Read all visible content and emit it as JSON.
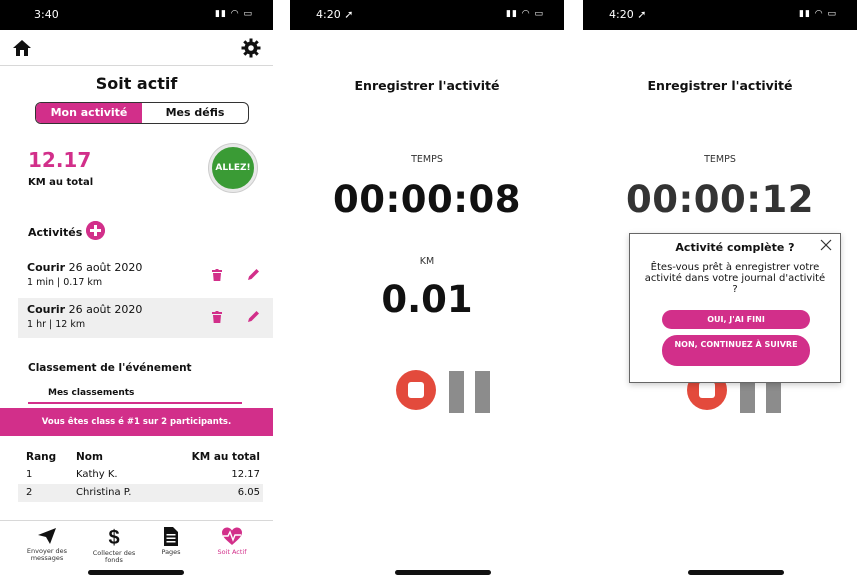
{
  "screen1": {
    "status_time": "3:40",
    "title": "Soit actif",
    "segment_tabs": [
      "Mon activité",
      "Mes défis"
    ],
    "total_value": "12.17",
    "total_label": "KM au total",
    "allez_label": "ALLEZ!",
    "activities_title": "Activités",
    "activities": [
      {
        "type": "Courir",
        "date": "26 août 2020",
        "details": "1 min | 0.17 km"
      },
      {
        "type": "Courir",
        "date": "26 août 2020",
        "details": "1 hr | 12 km"
      }
    ],
    "ranking_title": "Classement de l'événement",
    "ranking_tab": "Mes classements",
    "banner": "Vous êtes class é #1 sur 2 participants.",
    "ranking_headers": [
      "Rang",
      "Nom",
      "KM au total"
    ],
    "ranking_rows": [
      {
        "rank": "1",
        "name": "Kathy K.",
        "km": "12.17"
      },
      {
        "rank": "2",
        "name": "Christina P.",
        "km": "6.05"
      }
    ],
    "tabbar": [
      {
        "label": "Envoyer des messages",
        "icon": "paper-plane-icon"
      },
      {
        "label": "Collecter des fonds",
        "icon": "dollar-icon"
      },
      {
        "label": "Pages",
        "icon": "document-icon"
      },
      {
        "label": "Soit Actif",
        "icon": "heart-pulse-icon"
      }
    ],
    "accent_color": "#d22f8a",
    "allez_color": "#3a9b35"
  },
  "screen2": {
    "status_time": "4:20",
    "title": "Enregistrer l'activité",
    "temps_label": "TEMPS",
    "timer": "00:00:08",
    "km_label": "KM",
    "km_value": "0.01"
  },
  "screen3": {
    "status_time": "4:20",
    "title": "Enregistrer l'activité",
    "temps_label": "TEMPS",
    "timer": "00:00:12",
    "modal": {
      "title": "Activité complète ?",
      "text": "Êtes-vous prêt à enregistrer votre activité dans votre journal d'activité ?",
      "yes_button": "OUI, J'AI FINI",
      "no_button": "NON, CONTINUEZ À SUIVRE"
    }
  }
}
